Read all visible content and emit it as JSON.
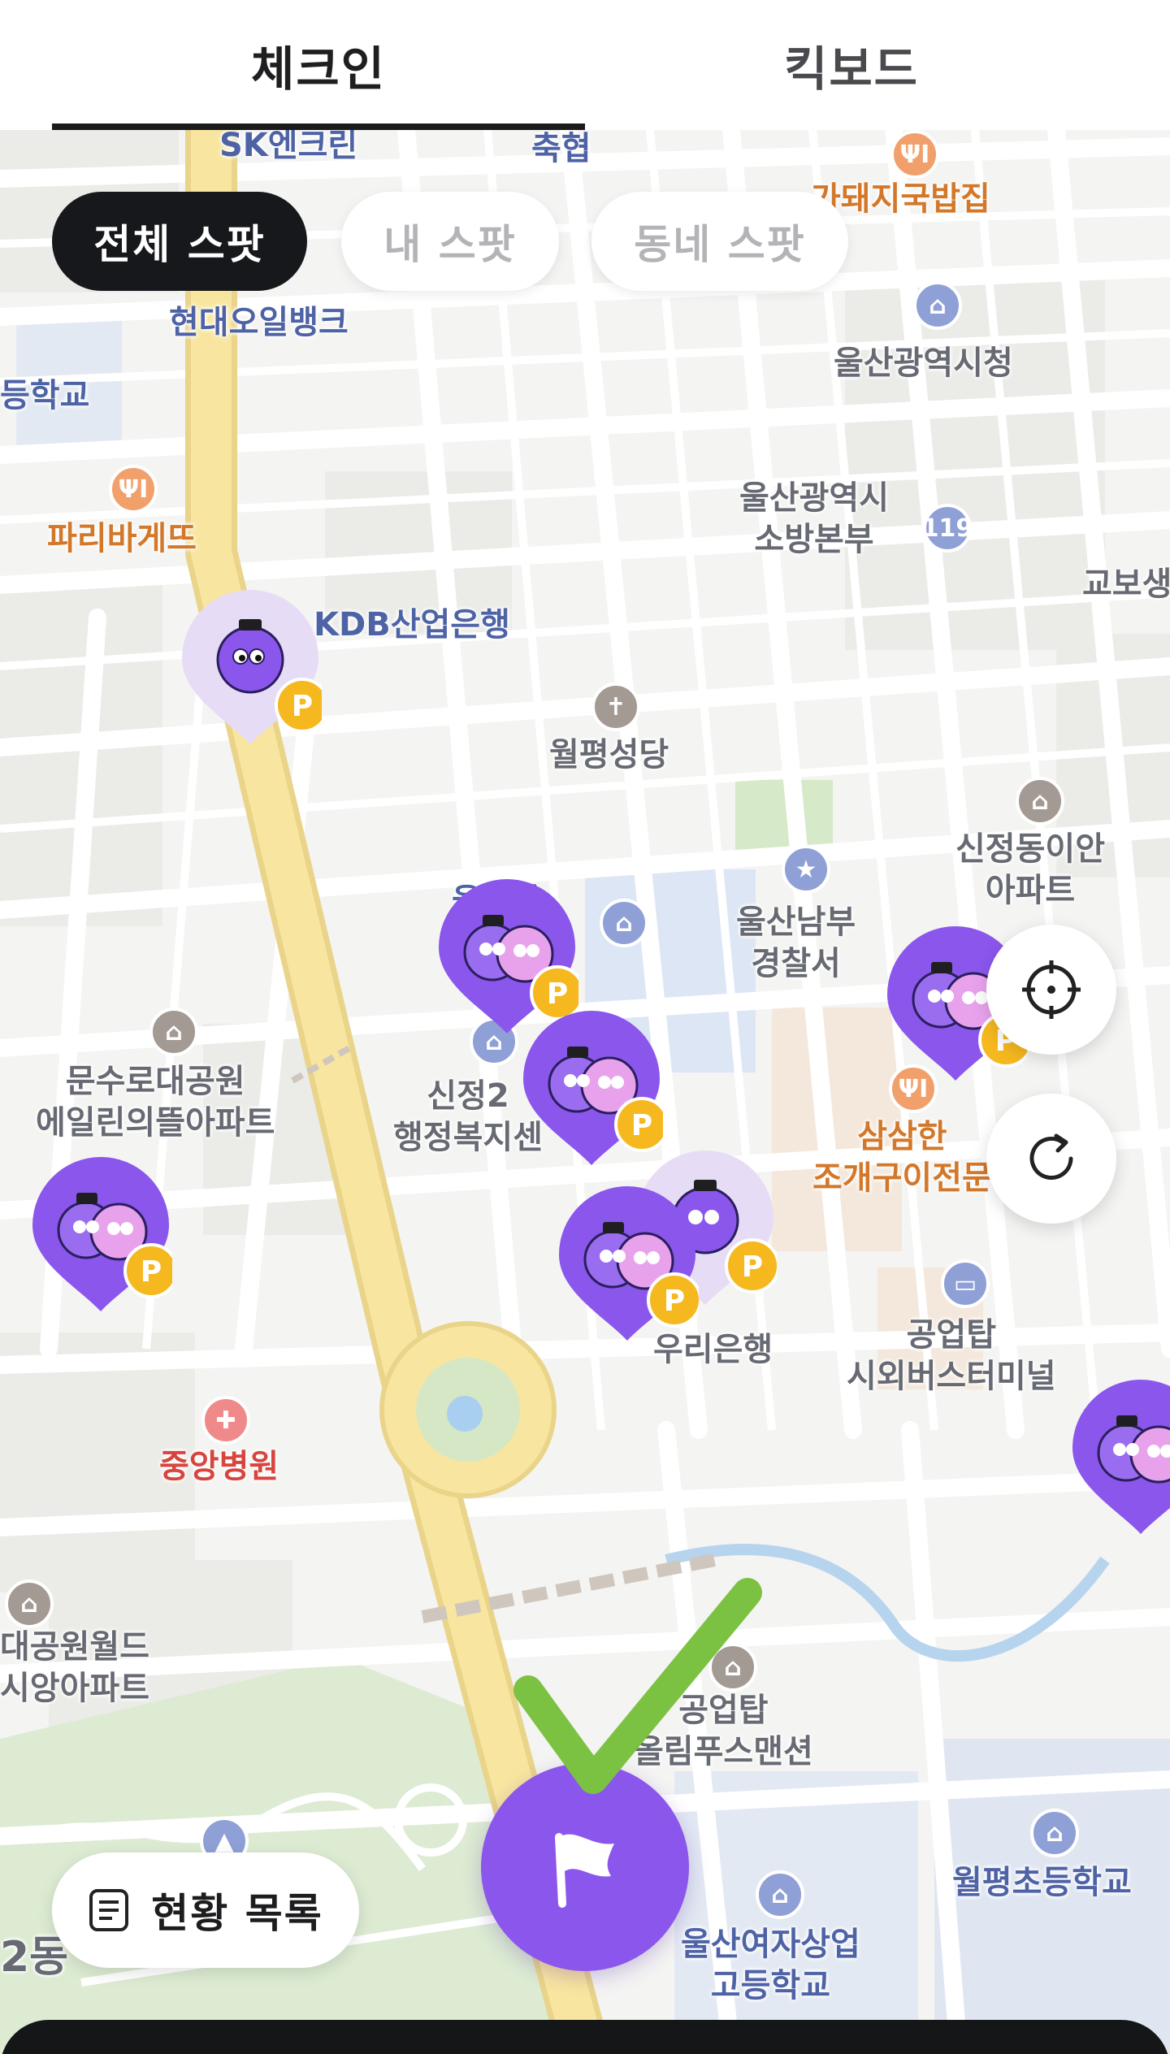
{
  "tabs": [
    {
      "label": "체크인",
      "active": true
    },
    {
      "label": "킥보드",
      "active": false
    }
  ],
  "filters": [
    {
      "label": "전체 스팟",
      "active": true
    },
    {
      "label": "내 스팟",
      "active": false
    },
    {
      "label": "동네 스팟",
      "active": false
    }
  ],
  "map": {
    "labels": {
      "sk": "SK엔크린",
      "chukhyup": "축협",
      "gukbap": "가돼지국밥집",
      "hyundai_oilbank": "현대오일뱅크",
      "school_left": "등학교",
      "ulsan_cityhall": "울산광역시청",
      "paris": "파리바게뜨",
      "fire_hq": "울산광역시\n소방본부",
      "kyobo": "교보생",
      "kdb": "KDB산업은행",
      "church": "월평성당",
      "sinjeong_apt": "신정동이안\n아파트",
      "police": "울산남부\n경찰서",
      "office_partial": "울산자\n고",
      "munsu_apt": "문수로대공원\n에일린의뜰아파트",
      "sinjeong2": "신정2\n행정복지센",
      "samsam": "삼삼한\n조개구이전문",
      "woori": "우리은행",
      "bus_terminal": "공업탑\n시외버스터미널",
      "central_hospital": "중앙병원",
      "world_apt": "대공원월드\n시앙아파트",
      "olympus": "공업탑\n올림푸스맨션",
      "wolpyeong_elem": "월평초등학교",
      "girls_high": "울산여자상업\n고등학교",
      "dong_partial": "2동"
    },
    "parking_badge": "P"
  },
  "buttons": {
    "status_list": "현황 목록",
    "locate_icon": "crosshair-icon",
    "refresh_icon": "refresh-icon",
    "checkin_icon": "flag-icon"
  },
  "colors": {
    "accent": "#8b56ec",
    "active_chip": "#17181b",
    "parking_badge": "#f5b81f",
    "check_green": "#7cc242",
    "main_road": "#f8e6a0"
  }
}
